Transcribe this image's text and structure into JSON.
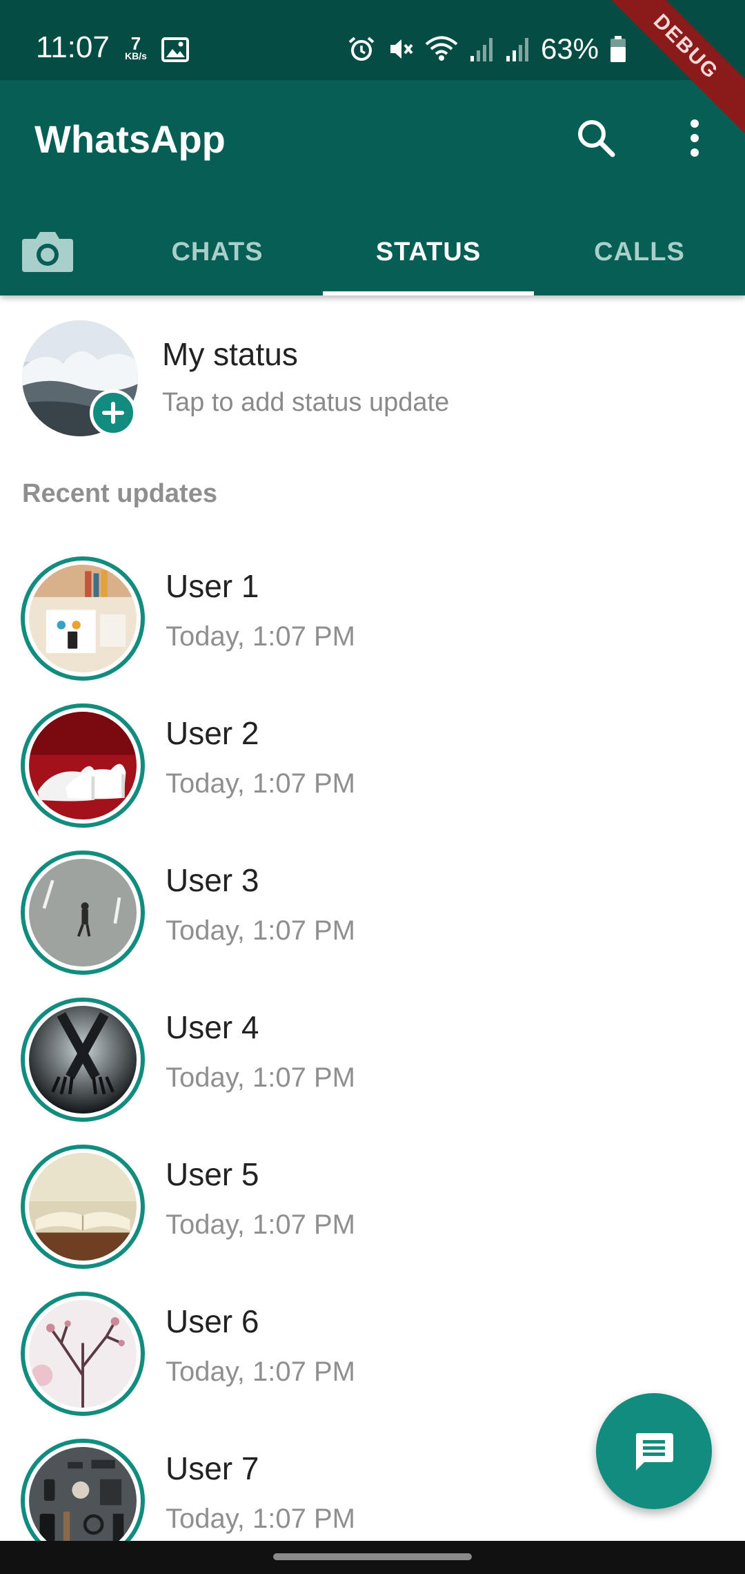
{
  "status_bar": {
    "time": "11:07",
    "net_speed_value": "7",
    "net_speed_unit": "KB/s",
    "battery": "63%",
    "icons": [
      "image-icon",
      "alarm-icon",
      "vibrate-mute-icon",
      "wifi-icon",
      "signal-icon",
      "signal-icon",
      "battery-icon"
    ]
  },
  "debug_banner": "DEBUG",
  "app_bar": {
    "title": "WhatsApp",
    "icons": [
      "search-icon",
      "more-vert-icon"
    ]
  },
  "tabs": [
    {
      "label": "CHATS",
      "active": false
    },
    {
      "label": "STATUS",
      "active": true
    },
    {
      "label": "CALLS",
      "active": false
    }
  ],
  "my_status": {
    "title": "My status",
    "subtitle": "Tap to add status update"
  },
  "recent_header": "Recent updates",
  "statuses": [
    {
      "name": "User 1",
      "time": "Today, 1:07 PM"
    },
    {
      "name": "User 2",
      "time": "Today, 1:07 PM"
    },
    {
      "name": "User 3",
      "time": "Today, 1:07 PM"
    },
    {
      "name": "User 4",
      "time": "Today, 1:07 PM"
    },
    {
      "name": "User 5",
      "time": "Today, 1:07 PM"
    },
    {
      "name": "User 6",
      "time": "Today, 1:07 PM"
    },
    {
      "name": "User 7",
      "time": "Today, 1:07 PM"
    }
  ],
  "fab_icon": "message-icon",
  "colors": {
    "status_bar": "#054d44",
    "app_bar": "#075e54",
    "accent": "#128c7e",
    "tab_inactive": "#a9cfca"
  }
}
